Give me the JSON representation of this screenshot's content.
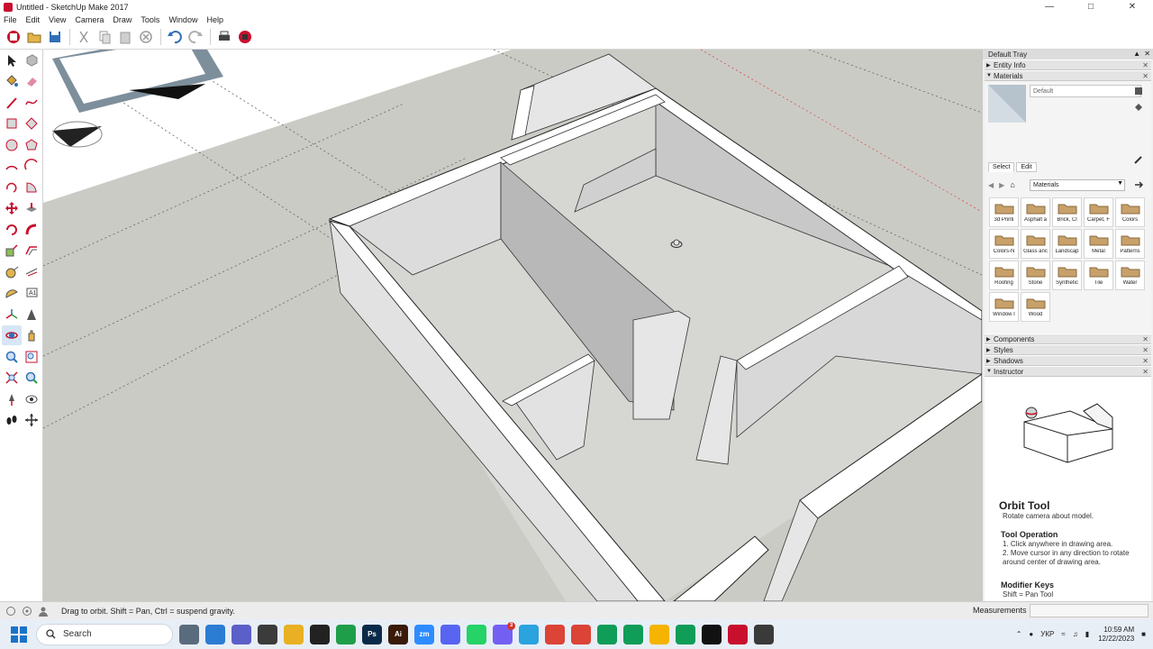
{
  "window": {
    "title": "Untitled - SketchUp Make 2017",
    "controls": [
      "minimize-icon",
      "maximize-icon",
      "close-icon"
    ]
  },
  "menu": [
    "File",
    "Edit",
    "View",
    "Camera",
    "Draw",
    "Tools",
    "Window",
    "Help"
  ],
  "toolbar": {
    "buttons": [
      "getting-started-icon",
      "open-icon",
      "save-icon",
      "cut-icon",
      "copy-icon",
      "paste-icon",
      "erase-icon",
      "undo-icon",
      "redo-icon",
      "print-icon",
      "model-info-icon"
    ]
  },
  "left_tools": [
    [
      "select-icon",
      "make-component-icon"
    ],
    [
      "paint-bucket-icon",
      "eraser-icon"
    ],
    [
      "line-icon",
      "freehand-icon"
    ],
    [
      "rectangle-icon",
      "rotated-rectangle-icon"
    ],
    [
      "circle-icon",
      "polygon-icon"
    ],
    [
      "arc-icon",
      "two-point-arc-icon"
    ],
    [
      "three-point-arc-icon",
      "pie-icon"
    ],
    [
      "move-icon",
      "push-pull-icon"
    ],
    [
      "rotate-icon",
      "follow-me-icon"
    ],
    [
      "scale-icon",
      "offset-icon"
    ],
    [
      "tape-measure-icon",
      "dimension-icon"
    ],
    [
      "protractor-icon",
      "text-icon"
    ],
    [
      "axes-icon",
      "3d-text-icon"
    ],
    [
      "orbit-icon",
      "pan-icon"
    ],
    [
      "zoom-icon",
      "zoom-window-icon"
    ],
    [
      "zoom-extents-icon",
      "previous-view-icon"
    ],
    [
      "position-camera-icon",
      "look-around-icon"
    ],
    [
      "walk-icon",
      "section-plane-icon"
    ]
  ],
  "tray": {
    "title": "Default Tray",
    "entity_info": "Entity Info",
    "materials": {
      "header": "Materials",
      "name_value": "Default",
      "tab_select": "Select",
      "tab_edit": "Edit",
      "library": "Materials",
      "items": [
        "3d Printi",
        "Asphalt a",
        "Brick, Cl",
        "Carpet, F",
        "Colors",
        "Colors-N",
        "Glass anc",
        "Landscap",
        "Metal",
        "Patterns",
        "Roofing",
        "Stone",
        "Synthetic",
        "Tile",
        "Water",
        "Window I",
        "Wood"
      ]
    },
    "components": "Components",
    "styles": "Styles",
    "shadows": "Shadows",
    "instructor": {
      "header": "Instructor",
      "title": "Orbit Tool",
      "subtitle": "Rotate camera about model.",
      "operation_heading": "Tool Operation",
      "steps": [
        "1. Click anywhere in drawing area.",
        "2. Move cursor in any direction to rotate around center of drawing area."
      ],
      "modifier_heading": "Modifier Keys",
      "shift": "Shift = Pan Tool"
    }
  },
  "status": {
    "text": "Drag to orbit. Shift = Pan, Ctrl = suspend gravity.",
    "measurements_label": "Measurements",
    "measurements_value": ""
  },
  "taskbar": {
    "search": "Search",
    "apps": [
      {
        "icon": "task-view-icon",
        "color": "#5a6b7d",
        "text": ""
      },
      {
        "icon": "onedrive-icon",
        "color": "#2b7cd3",
        "text": ""
      },
      {
        "icon": "teams-icon",
        "color": "#5b5fc7",
        "text": ""
      },
      {
        "icon": "calculator-icon",
        "color": "#3b3b3b",
        "text": ""
      },
      {
        "icon": "file-explorer-icon",
        "color": "#e8b022",
        "text": ""
      },
      {
        "icon": "capcut-icon",
        "color": "#222222",
        "text": ""
      },
      {
        "icon": "pycharm-icon",
        "color": "#1f9e4a",
        "text": ""
      },
      {
        "icon": "photoshop-icon",
        "color": "#0b2a4a",
        "text": "Ps"
      },
      {
        "icon": "illustrator-icon",
        "color": "#3a1a08",
        "text": "Ai"
      },
      {
        "icon": "zoom-icon",
        "color": "#2d8cff",
        "text": "zm"
      },
      {
        "icon": "discord-icon",
        "color": "#5865f2",
        "text": ""
      },
      {
        "icon": "whatsapp-icon",
        "color": "#25d366",
        "text": ""
      },
      {
        "icon": "viber-icon",
        "color": "#7360f2",
        "text": "",
        "badge": "3"
      },
      {
        "icon": "telegram-icon",
        "color": "#2aa3df",
        "text": ""
      },
      {
        "icon": "chrome-icon",
        "color": "#db4437",
        "text": ""
      },
      {
        "icon": "chrome-icon-2",
        "color": "#db4437",
        "text": ""
      },
      {
        "icon": "chrome-icon-3",
        "color": "#0f9d58",
        "text": ""
      },
      {
        "icon": "chrome-icon-4",
        "color": "#0f9d58",
        "text": ""
      },
      {
        "icon": "chrome-icon-5",
        "color": "#f4b400",
        "text": ""
      },
      {
        "icon": "chrome-icon-6",
        "color": "#0f9d58",
        "text": ""
      },
      {
        "icon": "record-icon",
        "color": "#111111",
        "text": ""
      },
      {
        "icon": "sketchup-icon",
        "color": "#c8102e",
        "text": ""
      },
      {
        "icon": "obs-icon",
        "color": "#3a3a3a",
        "text": ""
      }
    ],
    "language": "УКР",
    "time": "10:59 AM",
    "date": "12/22/2023"
  }
}
